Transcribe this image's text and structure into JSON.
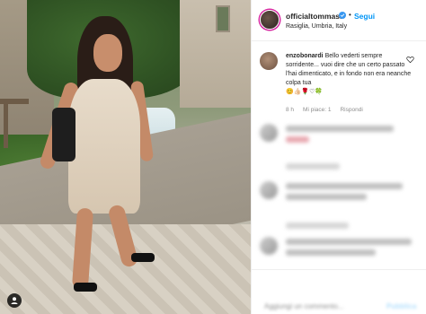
{
  "post": {
    "username": "officialtommasi",
    "follow_label": "Segui",
    "separator": "•",
    "location": "Rasiglia, Umbria, Italy"
  },
  "comment": {
    "author": "enzobonardi",
    "text": "Bello vederti sempre sorridente... vuoi dire che un certo passato l'hai dimenticato, e in fondo non era neanche colpa tua",
    "emojis": "😊👍🏻🌹♡🍀",
    "time": "8 h",
    "likes": "Mi piace: 1",
    "reply_label": "Rispondi"
  },
  "footer": {
    "placeholder": "Aggiungi un commento...",
    "publish_label": "Pubblica"
  },
  "colors": {
    "accent": "#0095f6",
    "verified": "#3897f0",
    "muted": "#8e8e8e"
  },
  "icons": [
    "verified-badge-icon",
    "heart-icon",
    "user-tag-icon"
  ]
}
